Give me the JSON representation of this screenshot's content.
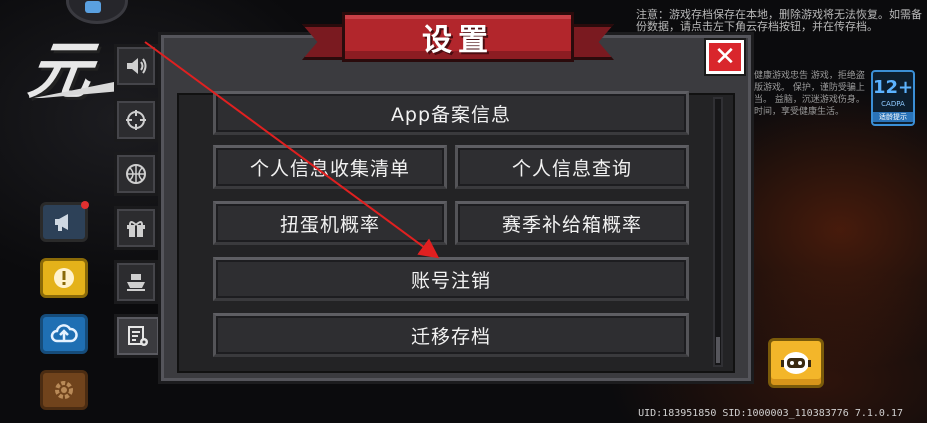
{
  "notice": {
    "text": "注意：游戏存档保存在本地，删除游戏将无法恢复。如需备份数据，请点击左下角云存档按钮，并在传存档。"
  },
  "health_notice": {
    "text": "健康游戏忠告 游戏，拒绝盗版游戏。 保护，谨防受骗上当。 益脑，沉迷游戏伤身。 时间，享受健康生活。"
  },
  "age_rating": {
    "age": "12+",
    "org": "CADPA",
    "tip": "适龄提示"
  },
  "dialog": {
    "title": "设置",
    "close_label": "✕",
    "buttons": {
      "icp_info": "App备案信息",
      "personal_info_list": "个人信息收集清单",
      "personal_info_query": "个人信息查询",
      "gacha_rate": "扭蛋机概率",
      "season_box_rate": "赛季补给箱概率",
      "account_cancel": "账号注销",
      "migrate_save": "迁移存档"
    }
  },
  "side_tabs": [
    {
      "icon": "speaker-icon"
    },
    {
      "icon": "crosshair-icon"
    },
    {
      "icon": "globe-icon"
    },
    {
      "icon": "gift-icon"
    },
    {
      "icon": "ship-icon"
    },
    {
      "icon": "settings-document-icon"
    }
  ],
  "left_buttons": [
    {
      "icon": "megaphone-icon",
      "color": "#2d4158"
    },
    {
      "icon": "alert-icon",
      "color": "#e4b21a"
    },
    {
      "icon": "cloud-upload-icon",
      "color": "#1f6fb3"
    },
    {
      "icon": "gear-icon",
      "color": "#70431c"
    }
  ],
  "footer": {
    "uid_text": "UID:183951850 SID:1000003_110383776 7.1.0.17"
  },
  "colors": {
    "ribbon": "#b2262c",
    "close": "#d9262c",
    "panel": "#3b3b3f",
    "arrow": "#e02020"
  }
}
